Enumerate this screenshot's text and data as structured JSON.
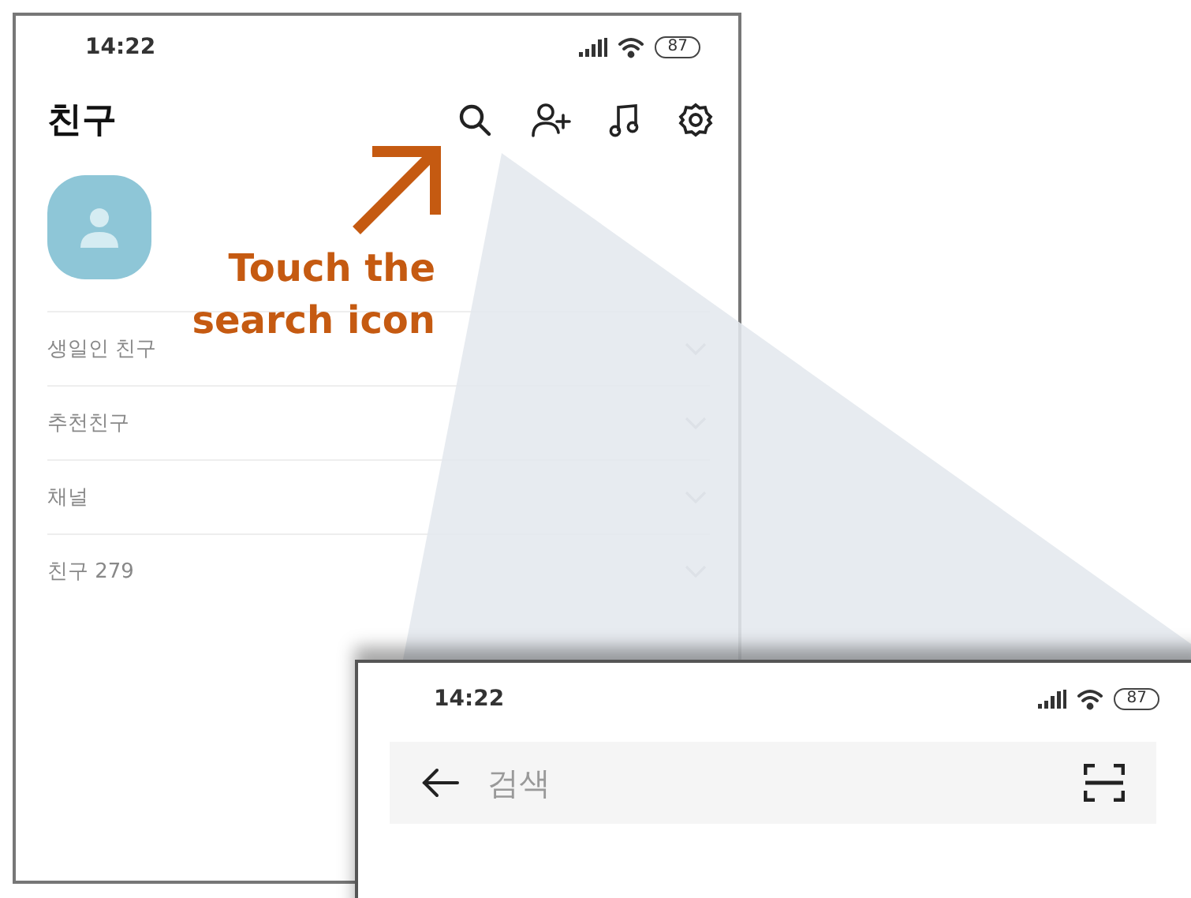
{
  "friends_screen": {
    "status_bar": {
      "time": "14:22",
      "battery": "87"
    },
    "title": "친구",
    "sections": [
      {
        "label": "생일인 친구"
      },
      {
        "label": "추천친구"
      },
      {
        "label": "채널"
      },
      {
        "label": "친구 279"
      }
    ]
  },
  "annotation": {
    "lines": [
      "Touch the",
      "search icon"
    ]
  },
  "search_screen": {
    "status_bar": {
      "time": "14:22",
      "battery": "87"
    },
    "search": {
      "placeholder": "검색"
    }
  }
}
